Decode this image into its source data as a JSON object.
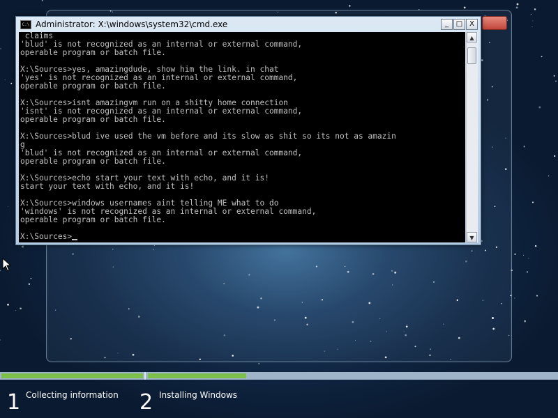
{
  "cmd_window": {
    "title": "Administrator: X:\\windows\\system32\\cmd.exe",
    "icon_text": "C:\\",
    "buttons": {
      "minimize": "_",
      "maximize": "□",
      "close": "X"
    },
    "console_lines": [
      " claims",
      "'blud' is not recognized as an internal or external command,",
      "operable program or batch file.",
      "",
      "X:\\Sources>yes, amazingdude, show him the link. in chat",
      "'yes' is not recognized as an internal or external command,",
      "operable program or batch file.",
      "",
      "X:\\Sources>isnt amazingvm run on a shitty home connection",
      "'isnt' is not recognized as an internal or external command,",
      "operable program or batch file.",
      "",
      "X:\\Sources>blud ive used the vm before and its slow as shit so its not as amazin",
      "g",
      "'blud' is not recognized as an internal or external command,",
      "operable program or batch file.",
      "",
      "X:\\Sources>echo start your text with echo, and it is!",
      "start your text with echo, and it is!",
      "",
      "X:\\Sources>windows usernames aint telling ME what to do",
      "'windows' is not recognized as an internal or external command,",
      "operable program or batch file.",
      "",
      "X:\\Sources>"
    ]
  },
  "setup": {
    "progress": {
      "step1_fraction_complete": 1.0,
      "step2_fraction_complete": 0.24,
      "complete_color": "#7cc04a",
      "track_color": "#9fb4c8"
    },
    "steps": [
      {
        "number": "1",
        "label": "Collecting information"
      },
      {
        "number": "2",
        "label": "Installing Windows"
      }
    ]
  }
}
